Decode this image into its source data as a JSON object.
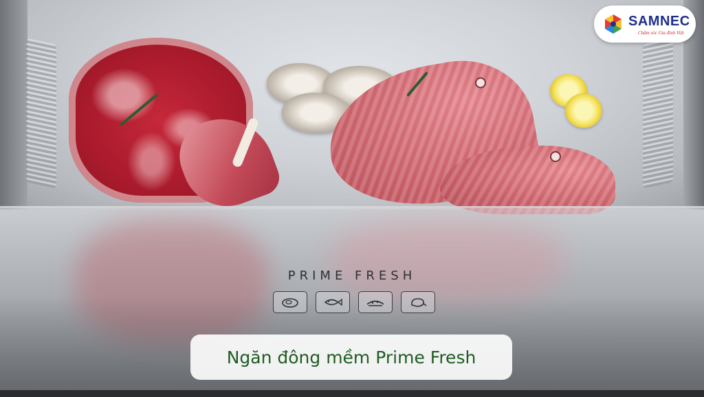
{
  "logo": {
    "name": "SAMNEC",
    "tagline": "Chăm sóc Gia đình Việt",
    "colors": [
      "#e53935",
      "#fbc02d",
      "#43a047",
      "#1e88e5",
      "#1f2f8c"
    ]
  },
  "drawer_label": "PRIME FRESH",
  "drawer_icons": [
    "steak-icon",
    "fish-icon",
    "seafood-icon",
    "poultry-icon"
  ],
  "caption": {
    "text": "Ngăn đông mềm Prime Fresh",
    "color": "#1f5c22"
  }
}
